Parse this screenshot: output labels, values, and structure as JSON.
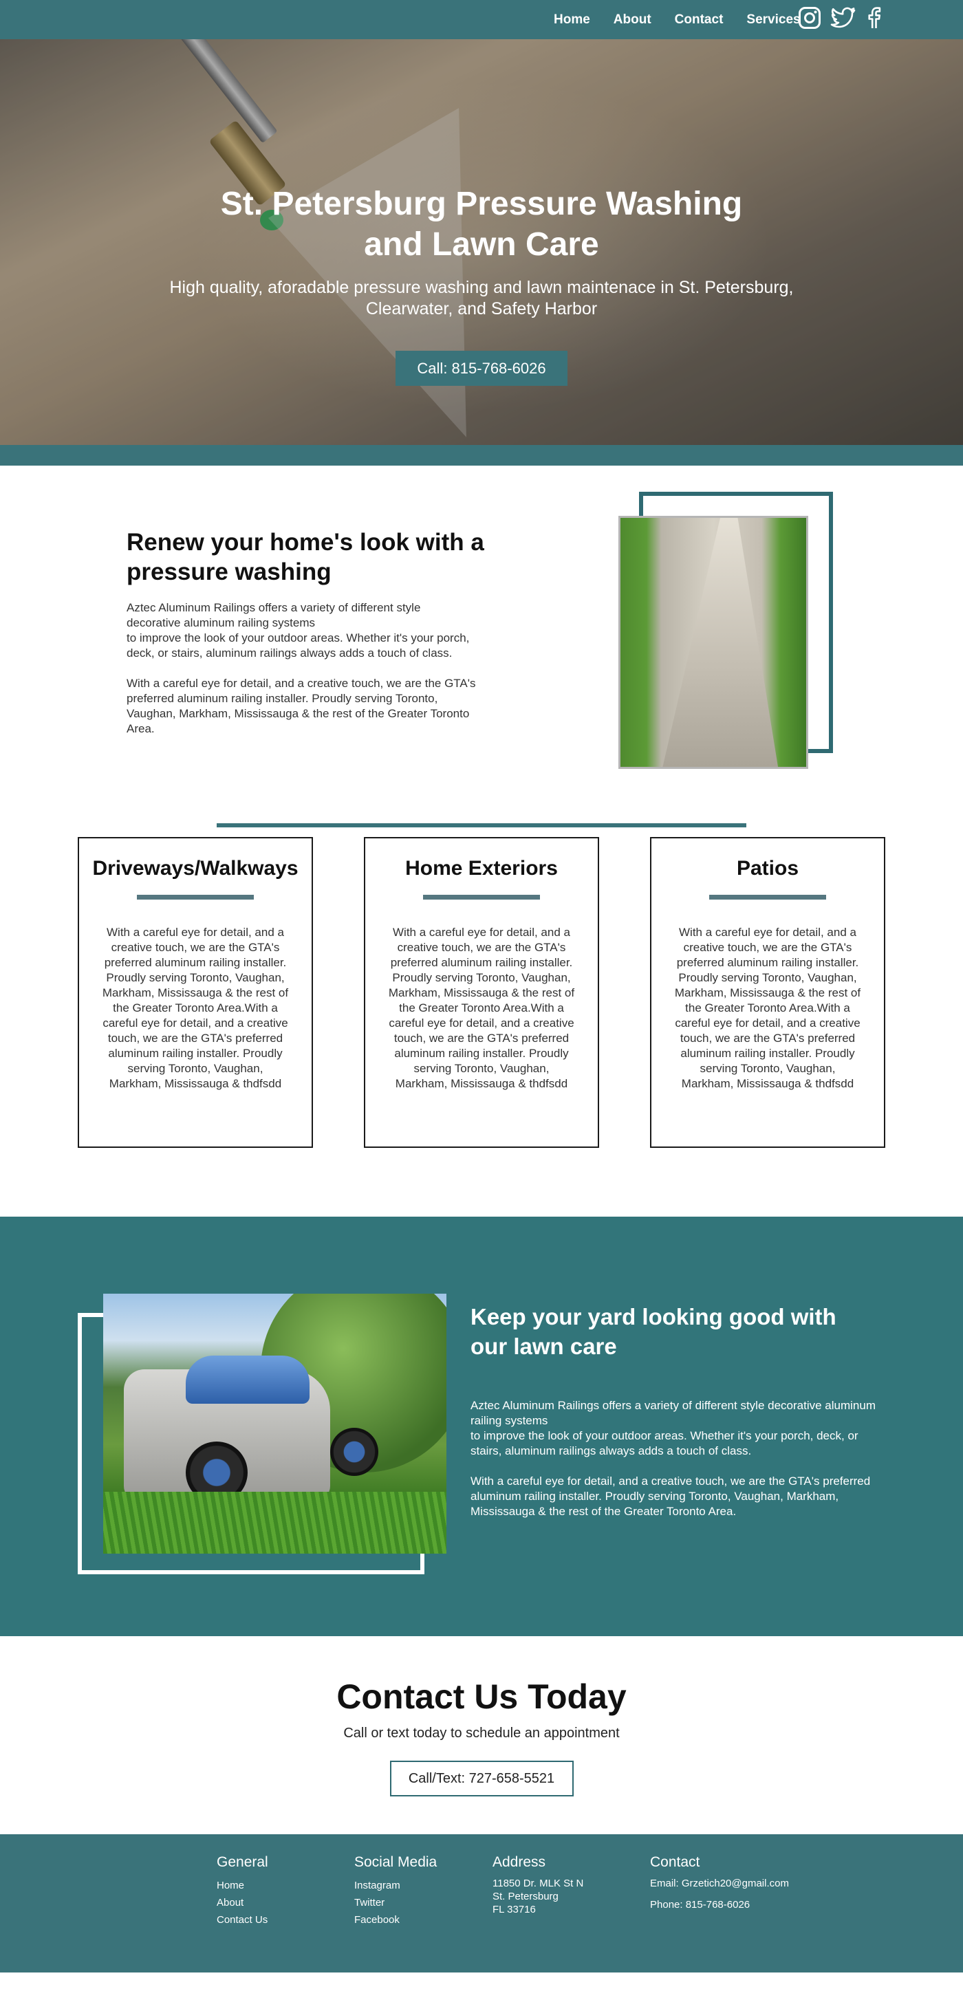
{
  "nav": {
    "links": [
      "Home",
      "About",
      "Contact",
      "Services"
    ],
    "icons": [
      "instagram-icon",
      "twitter-icon",
      "facebook-icon"
    ]
  },
  "hero": {
    "title": "St. Petersburg Pressure Washing and Lawn Care",
    "subtitle": "High quality, aforadable pressure washing and lawn maintenace in St. Petersburg, Clearwater, and Safety Harbor",
    "button": "Call: 815-768-6026"
  },
  "renew": {
    "title": "Renew your home's look with a pressure washing",
    "para1_line1": "Aztec Aluminum Railings offers a variety of different style decorative aluminum railing systems",
    "para1_line2": "to improve the look of your outdoor areas. Whether it's your porch, deck, or stairs, aluminum railings always adds a touch of class.",
    "para2": "With a careful eye for detail, and a creative touch, we are the GTA's preferred aluminum railing installer. Proudly serving Toronto, Vaughan, Markham, Mississauga & the rest of the Greater Toronto Area."
  },
  "services": [
    {
      "title": "Driveways/Walkways",
      "text": "With a careful eye for detail, and a creative touch, we are the GTA's preferred aluminum railing installer. Proudly serving Toronto, Vaughan, Markham, Mississauga & the rest of the Greater Toronto Area.With a careful eye for detail, and a creative touch, we are the GTA's preferred aluminum railing installer. Proudly serving Toronto, Vaughan, Markham, Mississauga & thdfsdd"
    },
    {
      "title": "Home Exteriors",
      "text": "With a careful eye for detail, and a creative touch, we are the GTA's preferred aluminum railing installer. Proudly serving Toronto, Vaughan, Markham, Mississauga & the rest of the Greater Toronto Area.With a careful eye for detail, and a creative touch, we are the GTA's preferred aluminum railing installer. Proudly serving Toronto, Vaughan, Markham, Mississauga & thdfsdd"
    },
    {
      "title": "Patios",
      "text": "With a careful eye for detail, and a creative touch, we are the GTA's preferred aluminum railing installer. Proudly serving Toronto, Vaughan, Markham, Mississauga & the rest of the Greater Toronto Area.With a careful eye for detail, and a creative touch, we are the GTA's preferred aluminum railing installer. Proudly serving Toronto, Vaughan, Markham, Mississauga & thdfsdd"
    }
  ],
  "lawn": {
    "title": "Keep your yard looking good with our lawn care",
    "para1_line1": "Aztec Aluminum Railings offers a variety of different style decorative aluminum railing systems",
    "para1_line2": "to improve the look of your outdoor areas. Whether it's your porch, deck, or stairs, aluminum railings always adds a touch of class.",
    "para2": "With a careful eye for detail, and a creative touch, we are the GTA's preferred aluminum railing installer. Proudly serving Toronto, Vaughan, Markham, Mississauga & the rest of the Greater Toronto Area."
  },
  "contact": {
    "title": "Contact Us Today",
    "subtitle": "Call or text today to schedule an appointment",
    "button": "Call/Text: 727-658-5521"
  },
  "footer": {
    "general": {
      "heading": "General",
      "links": [
        "Home",
        "About",
        "Contact Us"
      ]
    },
    "social": {
      "heading": "Social Media",
      "links": [
        "Instagram",
        "Twitter",
        "Facebook"
      ]
    },
    "address": {
      "heading": "Address",
      "line1": "11850 Dr. MLK St N",
      "line2": "St. Petersburg",
      "line3": "FL 33716"
    },
    "contact": {
      "heading": "Contact",
      "email": "Email: Grzetich20@gmail.com",
      "phone": "Phone: 815-768-6026"
    }
  },
  "colors": {
    "teal": "#3a737a",
    "teal_dark": "#32757a",
    "frame": "#2f6a72"
  }
}
